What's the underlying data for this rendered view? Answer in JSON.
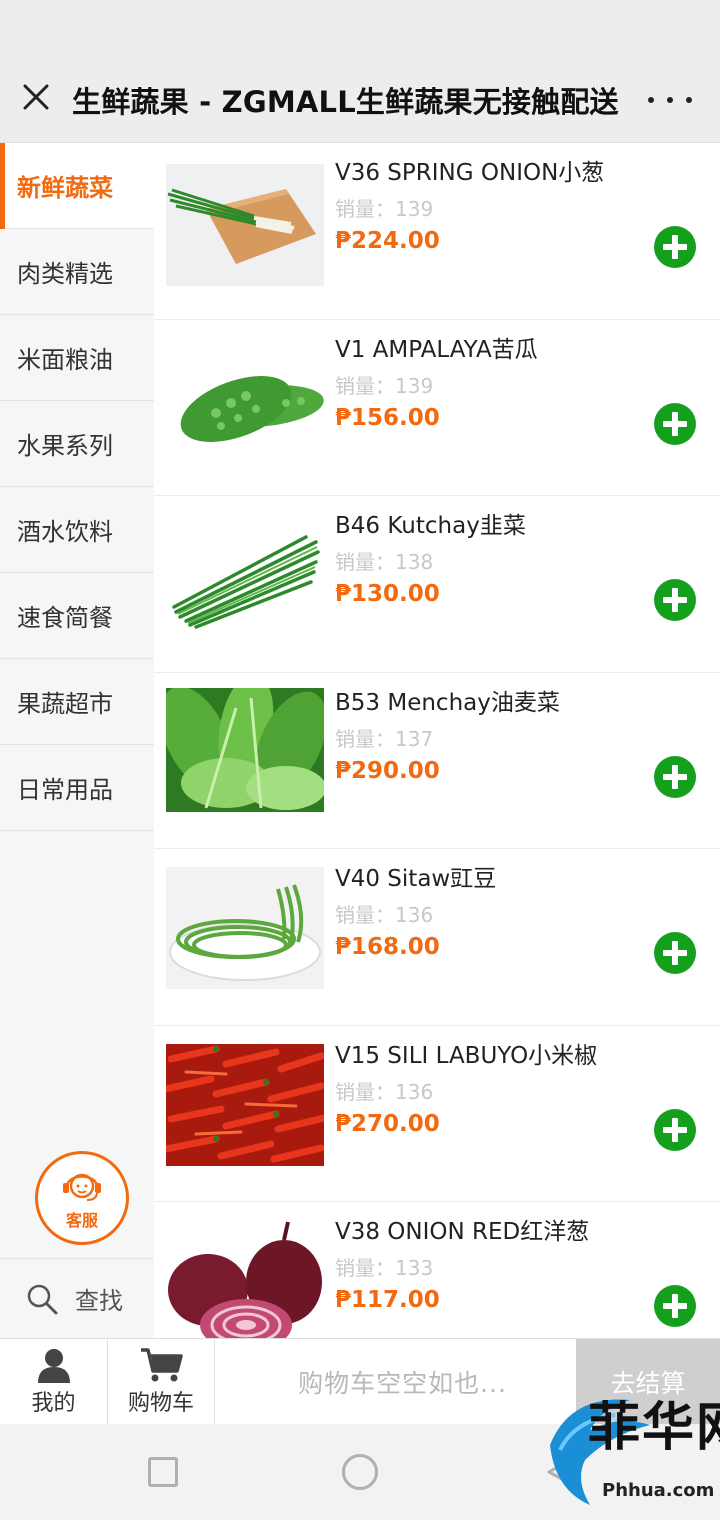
{
  "header": {
    "title": "生鲜蔬果 - ZGMALL生鲜蔬果无接触配送"
  },
  "sidebar": {
    "categories": [
      {
        "label": "新鲜蔬菜",
        "active": true
      },
      {
        "label": "肉类精选",
        "active": false
      },
      {
        "label": "米面粮油",
        "active": false
      },
      {
        "label": "水果系列",
        "active": false
      },
      {
        "label": "酒水饮料",
        "active": false
      },
      {
        "label": "速食简餐",
        "active": false
      },
      {
        "label": "果蔬超市",
        "active": false
      },
      {
        "label": "日常用品",
        "active": false
      }
    ],
    "service_label": "客服",
    "search_label": "查找"
  },
  "products": [
    {
      "name": "V36 SPRING ONION小葱",
      "sales": "销量：139",
      "price": "₱224.00"
    },
    {
      "name": "V1 AMPALAYA苦瓜",
      "sales": "销量：139",
      "price": "₱156.00"
    },
    {
      "name": "B46 Kutchay韭菜",
      "sales": "销量：138",
      "price": "₱130.00"
    },
    {
      "name": "B53 Menchay油麦菜",
      "sales": "销量：137",
      "price": "₱290.00"
    },
    {
      "name": "V40 Sitaw豇豆",
      "sales": "销量：136",
      "price": "₱168.00"
    },
    {
      "name": "V15 SILI LABUYO小米椒",
      "sales": "销量：136",
      "price": "₱270.00"
    },
    {
      "name": "V38 ONION RED红洋葱",
      "sales": "销量：133",
      "price": "₱117.00"
    }
  ],
  "cart_bar": {
    "mine_label": "我的",
    "cart_label": "购物车",
    "empty_text": "购物车空空如也...",
    "checkout_label": "去结算"
  },
  "watermark": {
    "text": "菲华网",
    "url": "Phhua.com"
  },
  "colors": {
    "accent": "#f26a10",
    "add_button": "#14a01d",
    "checkout_disabled": "#cfcfcf"
  }
}
